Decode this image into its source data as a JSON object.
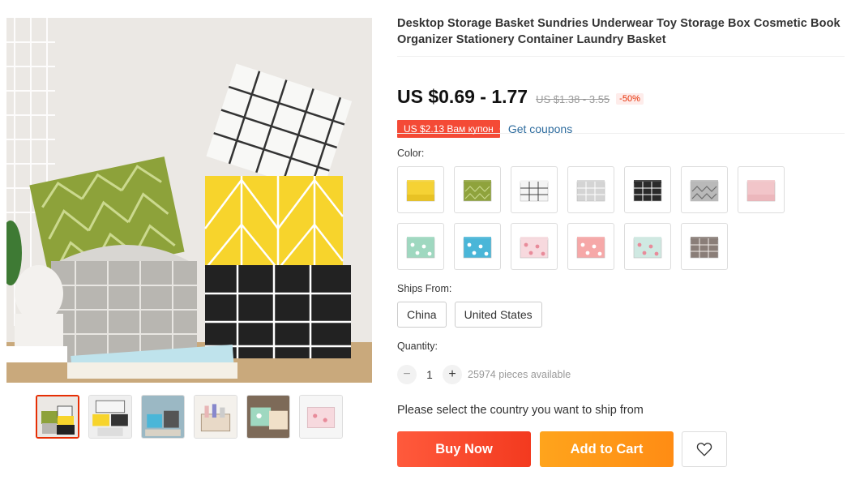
{
  "product": {
    "title": "Desktop Storage Basket Sundries Underwear Toy Storage Box Cosmetic Book Organizer Stationery Container Laundry Basket",
    "price": "US $0.69 - 1.77",
    "original_price": "US $1.38 - 3.55",
    "discount": "-50%",
    "coupon_badge": "US $2.13 Вам купон",
    "get_coupons": "Get coupons"
  },
  "gallery": {
    "thumbnails": [
      {
        "name": "thumb-basket-set",
        "active": true
      },
      {
        "name": "thumb-baskets-shelf"
      },
      {
        "name": "thumb-baskets-desk"
      },
      {
        "name": "thumb-baskets-cosmetics"
      },
      {
        "name": "thumb-baskets-closeup"
      },
      {
        "name": "thumb-flamingo-basket"
      }
    ]
  },
  "color": {
    "label": "Color:",
    "options": [
      {
        "name": "yellow",
        "base": "#f5d234",
        "pattern": "#e0b81a",
        "style": "plain"
      },
      {
        "name": "green-chevron",
        "base": "#8fa33c",
        "pattern": "#c8d68a",
        "style": "chevron"
      },
      {
        "name": "white-grid",
        "base": "#f4f4f4",
        "pattern": "#444444",
        "style": "grid"
      },
      {
        "name": "grey-grid",
        "base": "#d4d4d4",
        "pattern": "#ffffff",
        "style": "grid"
      },
      {
        "name": "black-grid",
        "base": "#2a2a2a",
        "pattern": "#ffffff",
        "style": "grid"
      },
      {
        "name": "grey-pattern",
        "base": "#b9b9b9",
        "pattern": "#6e6e6e",
        "style": "chevron"
      },
      {
        "name": "pink",
        "base": "#f2c5c9",
        "pattern": "#e8aeb4",
        "style": "plain"
      },
      {
        "name": "mint-cactus",
        "base": "#9fd8c0",
        "pattern": "#ffffff",
        "style": "dots"
      },
      {
        "name": "blue-bear",
        "base": "#4ab6d8",
        "pattern": "#ffffff",
        "style": "dots"
      },
      {
        "name": "pink-flamingo",
        "base": "#f7d9de",
        "pattern": "#e88b9a",
        "style": "dots"
      },
      {
        "name": "coral-flamingo",
        "base": "#f6a8a8",
        "pattern": "#ffffff",
        "style": "dots"
      },
      {
        "name": "mint-flamingo",
        "base": "#cfe9e2",
        "pattern": "#e88b9a",
        "style": "dots"
      },
      {
        "name": "brown-grid",
        "base": "#8a7e78",
        "pattern": "#f1ece8",
        "style": "grid"
      }
    ]
  },
  "shipping": {
    "label": "Ships From:",
    "options": [
      "China",
      "United States"
    ]
  },
  "quantity": {
    "label": "Quantity:",
    "value": "1",
    "minus": "−",
    "plus": "+",
    "available": "25974 pieces available"
  },
  "ship_note": "Please select the country you want to ship from",
  "actions": {
    "buy_now": "Buy Now",
    "add_to_cart": "Add to Cart",
    "wishlist_icon": "heart-outline-icon"
  },
  "colors": {
    "accent": "#e62e04",
    "buy_now": "#f33a1f",
    "add_to_cart": "#ff8c14",
    "link": "#2e6c9e"
  }
}
